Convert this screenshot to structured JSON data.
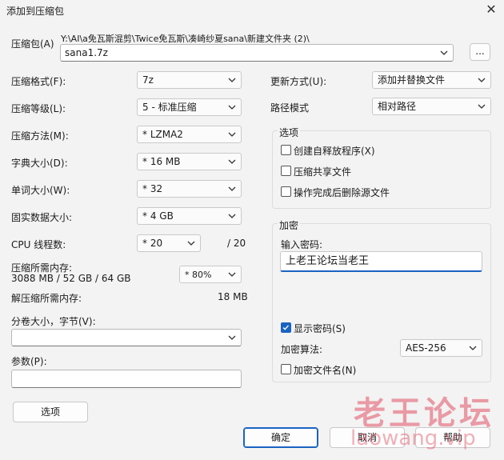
{
  "window": {
    "title": "添加到压缩包"
  },
  "archive": {
    "label": "压缩包(A)",
    "path": "Y:\\AI\\a免瓦斯混剪\\Twice免瓦斯\\凑崎纱夏sana\\新建文件夹 (2)\\",
    "name": "sana1.7z",
    "browse_label": "..."
  },
  "left": {
    "format": {
      "label": "压缩格式(F):",
      "value": "7z"
    },
    "level": {
      "label": "压缩等级(L):",
      "value": "5 - 标准压缩"
    },
    "method": {
      "label": "压缩方法(M):",
      "value": "*  LZMA2"
    },
    "dict": {
      "label": "字典大小(D):",
      "value": "*  16 MB"
    },
    "word": {
      "label": "单词大小(W):",
      "value": "*  32"
    },
    "solid": {
      "label": "固实数据大小:",
      "value": "*  4 GB"
    },
    "threads": {
      "label": "CPU 线程数:",
      "value": "*  20",
      "total": "/ 20"
    },
    "mem_comp": {
      "label": "压缩所需内存:",
      "detail": "3088 MB / 52 GB / 64 GB",
      "value": "* 80%"
    },
    "mem_decomp": {
      "label": "解压缩所需内存:",
      "value": "18 MB"
    },
    "split": {
      "label": "分卷大小，字节(V):",
      "value": ""
    },
    "params": {
      "label": "参数(P):",
      "value": ""
    },
    "options_button": "选项"
  },
  "right": {
    "update": {
      "label": "更新方式(U):",
      "value": "添加并替换文件"
    },
    "pathmode": {
      "label": "路径模式",
      "value": "相对路径"
    },
    "options": {
      "title": "选项",
      "sfx": {
        "label": "创建自释放程序(X)",
        "checked": false
      },
      "shared": {
        "label": "压缩共享文件",
        "checked": false
      },
      "delete": {
        "label": "操作完成后删除源文件",
        "checked": false
      }
    },
    "encryption": {
      "title": "加密",
      "pwd_label": "输入密码:",
      "pwd_value": "上老王论坛当老王",
      "show_pwd": {
        "label": "显示密码(S)",
        "checked": true
      },
      "method_label": "加密算法:",
      "method_value": "AES-256",
      "encrypt_names": {
        "label": "加密文件名(N)",
        "checked": false
      }
    }
  },
  "buttons": {
    "ok": "确定",
    "cancel": "取消",
    "help": "帮助"
  },
  "watermark": {
    "line1": "老王论坛",
    "line2": "laowang.vip"
  },
  "colors": {
    "accent": "#1a63c2",
    "watermark": "#e05064"
  }
}
